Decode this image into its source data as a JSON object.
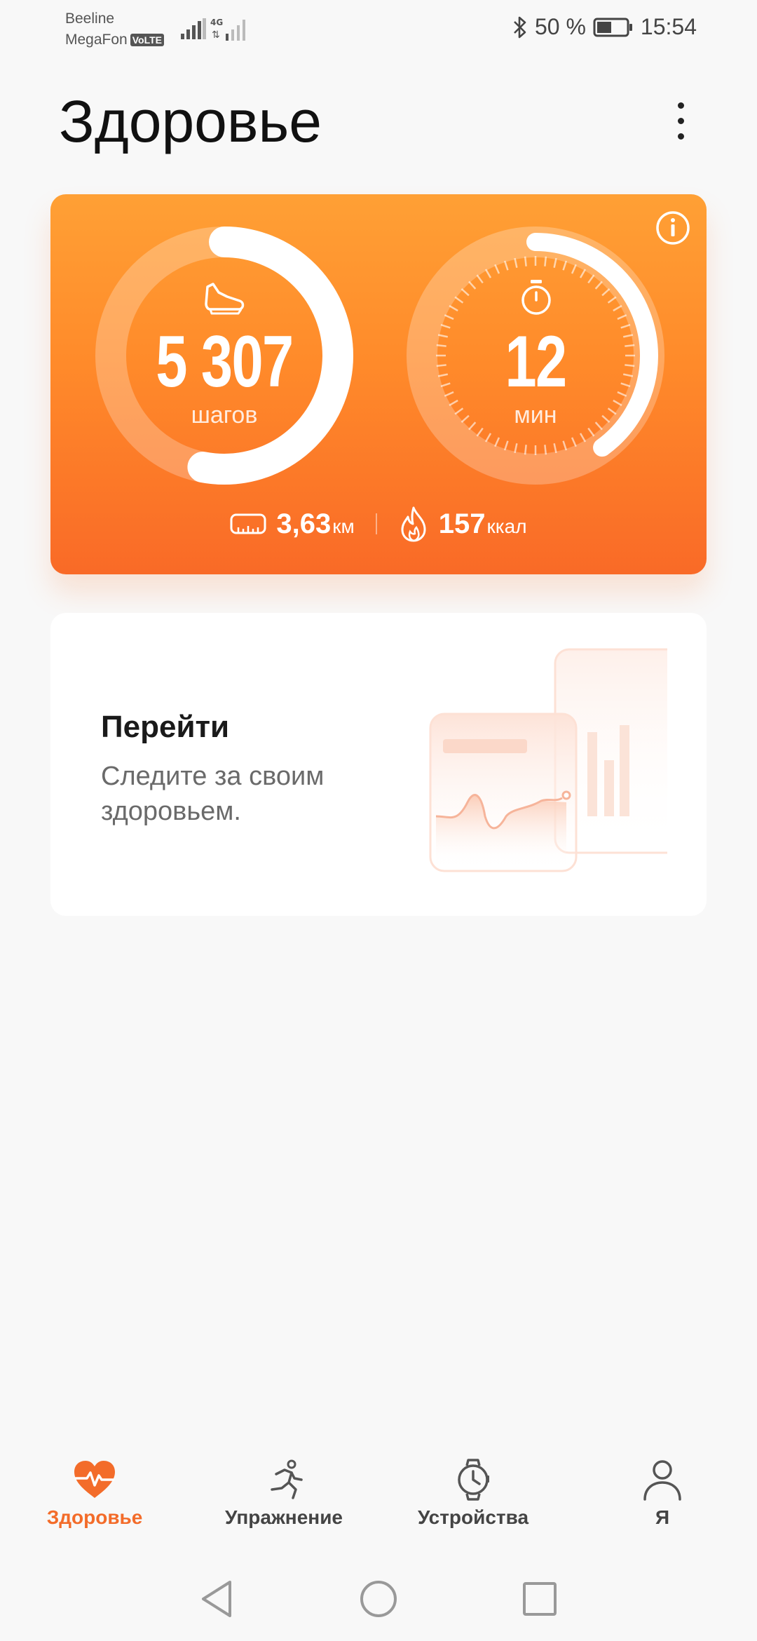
{
  "status_bar": {
    "carrier1": "Beeline",
    "carrier2": "MegaFon",
    "volte": "VoLTE",
    "network": "4G",
    "battery": "50 %",
    "time": "15:54"
  },
  "header": {
    "title": "Здоровье"
  },
  "activity": {
    "steps_value": "5 307",
    "steps_unit": "шагов",
    "steps_progress": 0.53,
    "minutes_value": "12",
    "minutes_unit": "мин",
    "minutes_progress": 0.4,
    "distance_value": "3,63",
    "distance_unit": "км",
    "calories_value": "157",
    "calories_unit": "ккал"
  },
  "promo": {
    "title": "Перейти",
    "text": "Следите за своим здоровьем."
  },
  "bottom_nav": {
    "items": [
      {
        "label": "Здоровье",
        "icon": "heart-pulse-icon",
        "active": true
      },
      {
        "label": "Упражнение",
        "icon": "running-icon",
        "active": false
      },
      {
        "label": "Устройства",
        "icon": "watch-icon",
        "active": false
      },
      {
        "label": "Я",
        "icon": "person-icon",
        "active": false
      }
    ]
  },
  "colors": {
    "accent": "#f36c2a",
    "card_top": "#ffa035",
    "card_bottom": "#f96a27"
  }
}
